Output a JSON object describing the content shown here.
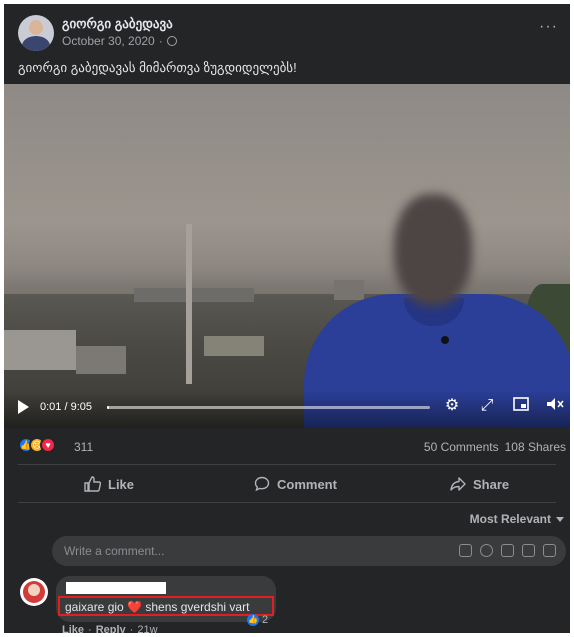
{
  "post": {
    "author": "გიორგი გაბედავა",
    "date": "October 30, 2020",
    "dot": "·",
    "more": "···",
    "text": "გიორგი გაბედავას მიმართვა ზუგდიდელებს!"
  },
  "video": {
    "time": "0:01 / 9:05",
    "progress_fraction": 0.004
  },
  "stats": {
    "reaction_count": "311",
    "comments": "50 Comments",
    "shares": "108 Shares",
    "reaction_icons": [
      "like-icon",
      "sad-icon",
      "love-icon"
    ]
  },
  "actions": {
    "like": "Like",
    "comment": "Comment",
    "share": "Share"
  },
  "sort": {
    "label": "Most Relevant"
  },
  "composer": {
    "placeholder": "Write a comment..."
  },
  "comment": {
    "text_before": "gaixare gio",
    "heart": "❤️",
    "text_after": "shens gverdshi vart",
    "like_count": "2",
    "like": "Like",
    "separator": "·",
    "reply": "Reply",
    "age": "21w"
  },
  "colors": {
    "background": "#242526",
    "highlight": "#e02020",
    "accent": "#1877f2"
  }
}
